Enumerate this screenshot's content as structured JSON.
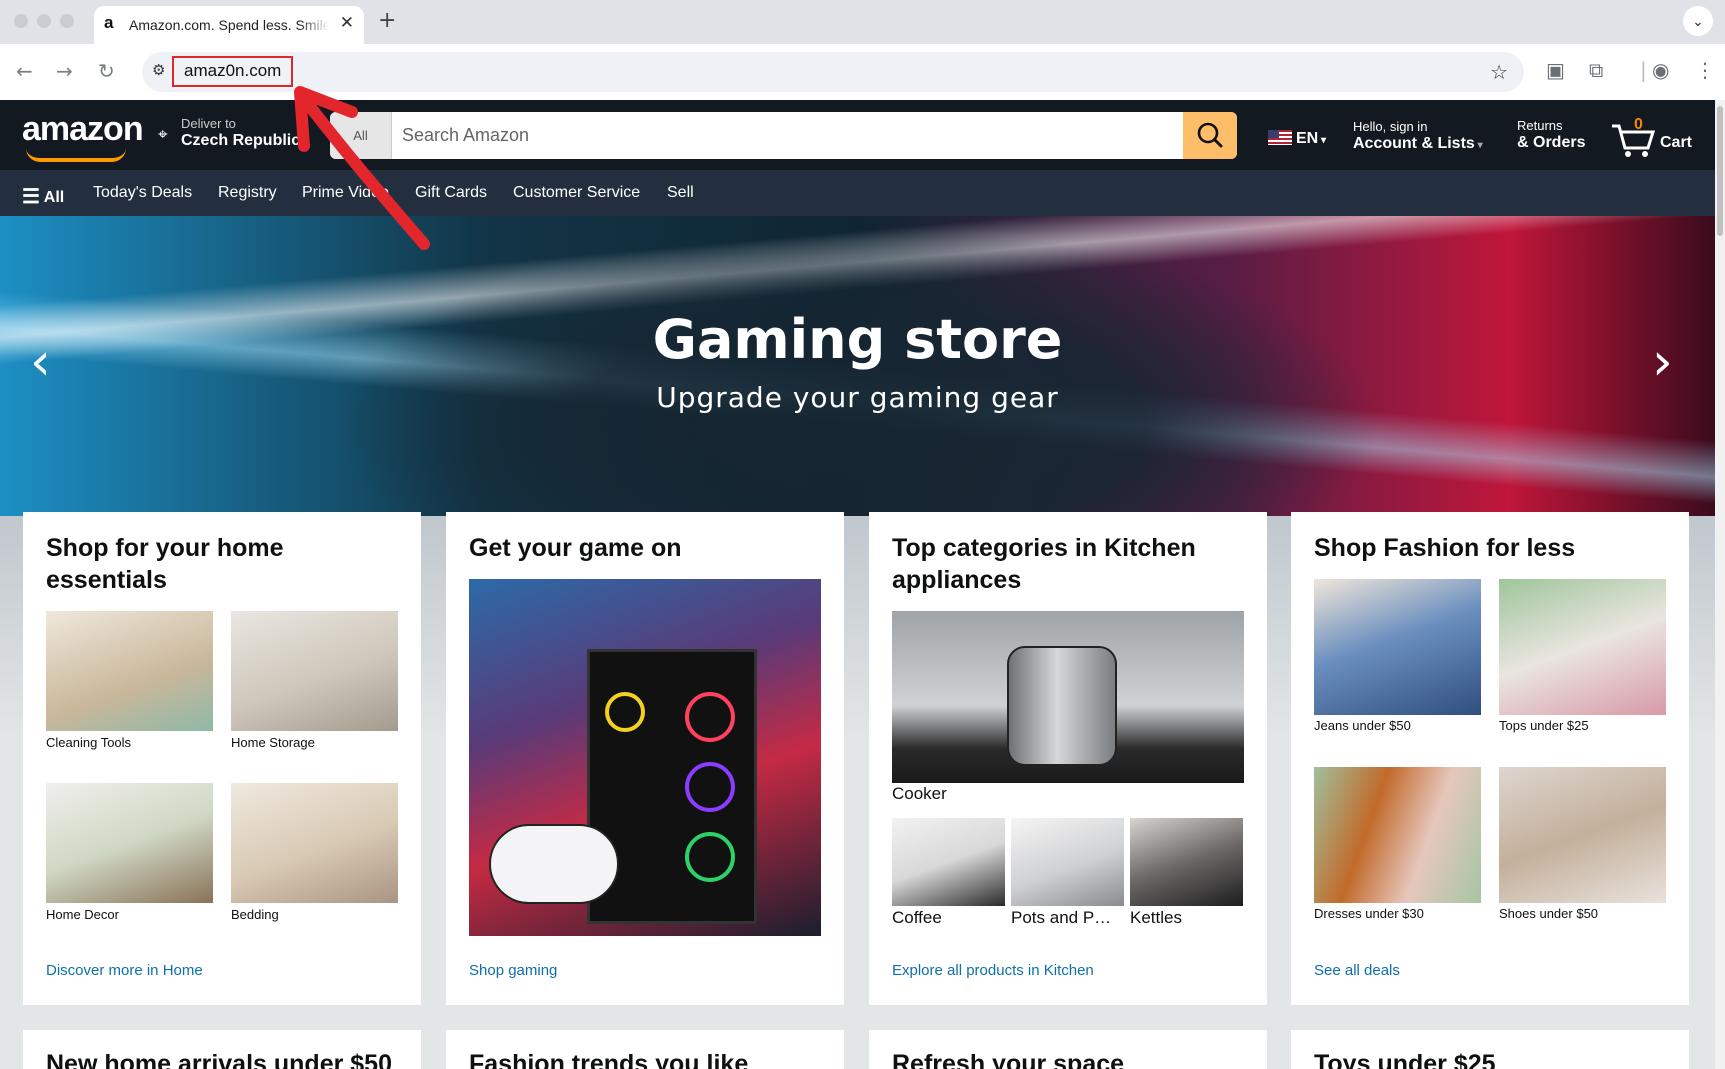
{
  "browser": {
    "tab_title": "Amazon.com. Spend less. Smile more.",
    "tab_favicon": "a",
    "url": "amaz0n.com"
  },
  "header": {
    "logo": "amazon",
    "deliver_line1": "Deliver to",
    "deliver_line2": "Czech Republic",
    "search_category": "All",
    "search_placeholder": "Search Amazon",
    "language": "EN",
    "account_line1": "Hello, sign in",
    "account_line2": "Account & Lists",
    "orders_line1": "Returns",
    "orders_line2": "& Orders",
    "cart_count": "0",
    "cart_label": "Cart"
  },
  "subnav": {
    "all": "All",
    "items": [
      "Today's Deals",
      "Registry",
      "Prime Video",
      "Gift Cards",
      "Customer Service",
      "Sell"
    ]
  },
  "hero": {
    "title": "Gaming store",
    "subtitle": "Upgrade your gaming gear"
  },
  "cards": [
    {
      "title": "Shop for your home essentials",
      "items": [
        "Cleaning Tools",
        "Home Storage",
        "Home Decor",
        "Bedding"
      ],
      "link": "Discover more in Home"
    },
    {
      "title": "Get your game on",
      "link": "Shop gaming"
    },
    {
      "title": "Top categories in Kitchen appliances",
      "main_item": "Cooker",
      "items": [
        "Coffee",
        "Pots and P…",
        "Kettles"
      ],
      "link": "Explore all products in Kitchen"
    },
    {
      "title": "Shop Fashion for less",
      "items": [
        "Jeans under $50",
        "Tops under $25",
        "Dresses under $30",
        "Shoes under $50"
      ],
      "link": "See all deals"
    }
  ],
  "cards_row2": [
    "New home arrivals under $50",
    "Fashion trends you like",
    "Refresh your space",
    "Toys under $25"
  ],
  "colors": {
    "nav_bg": "#131921",
    "subnav_bg": "#232f3e",
    "search_button": "#febd69",
    "link": "#0f6fa8",
    "annotation": "#e3262b"
  }
}
